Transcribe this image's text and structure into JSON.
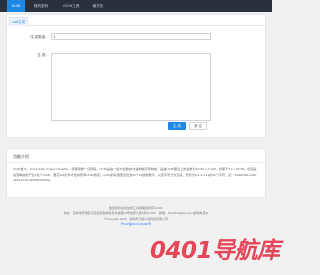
{
  "nav": {
    "items": [
      {
        "label": "UUID",
        "active": true
      },
      {
        "label": "随机密码",
        "active": false
      },
      {
        "label": "JSON工具",
        "active": false
      },
      {
        "label": "格式化",
        "active": false
      }
    ]
  },
  "tool": {
    "tab_label": "uuid生成",
    "count_label": "生成数量：",
    "count_value": "1",
    "result_label": "生 成：",
    "generate_label": "生 成",
    "clear_label": "清 空"
  },
  "info": {
    "title": "功能介绍",
    "text": "UUID含义：Universally Unique Identifier，即通用唯一识别码。UUID是由一组32位数的16进制数字所构成，是故UUID理论上的总数为16^32 = 2^128，约等于3.4 x 10^38。也就是说若每纳秒产生1兆个UUID，要花100亿年才会将所有UUID用完。UUID的标准型式包含32个16进制数字，以连字号分为五段，形式为8-4-4-4-12的32个字符，如：550e8400-e29b-41d4-a716-446655440000。"
  },
  "footer": {
    "line1": "独创所有在线生成工具网版权所有©2021",
    "line2": "地址：深圳市罗湖区东晓街道独秀社区布吉路10号嘉宾大厦5层10-022　邮箱：3013540@qq.com 邮购电话@",
    "line3": "©Copyright 2022 - 深圳市万联众创科技有限公司",
    "beian": "粤ICP备2021109206号"
  },
  "watermark": "0401导航库",
  "colors": {
    "nav_bg": "#2b303d",
    "accent": "#1e88e5",
    "watermark": "#e4384c"
  }
}
